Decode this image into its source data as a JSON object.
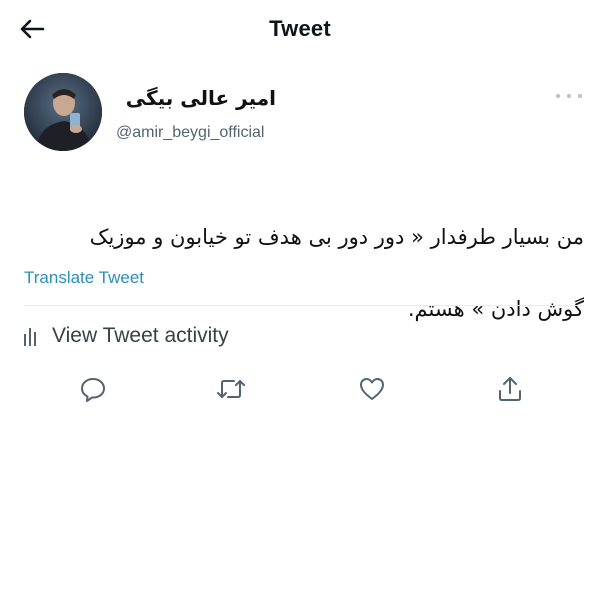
{
  "header": {
    "title": "Tweet"
  },
  "author": {
    "display_name": "امیر عالی بیگی",
    "handle": "@amir_beygi_official"
  },
  "tweet": {
    "text_line1": "من بسیار طرفدار « دور دور بی هدف تو خیابون و موزیک",
    "text_line2": "گوش دادن » هستم.",
    "translate_label": "Translate Tweet"
  },
  "activity": {
    "label": "View Tweet activity"
  },
  "icons": {
    "back": "arrow-left-icon",
    "more": "more-horizontal-icon",
    "activity": "bar-chart-icon",
    "reply": "reply-icon",
    "retweet": "retweet-icon",
    "like": "heart-icon",
    "share": "share-icon"
  },
  "colors": {
    "link": "#2c8fb8",
    "secondary_text": "#536471",
    "divider": "#e6ecf0"
  }
}
